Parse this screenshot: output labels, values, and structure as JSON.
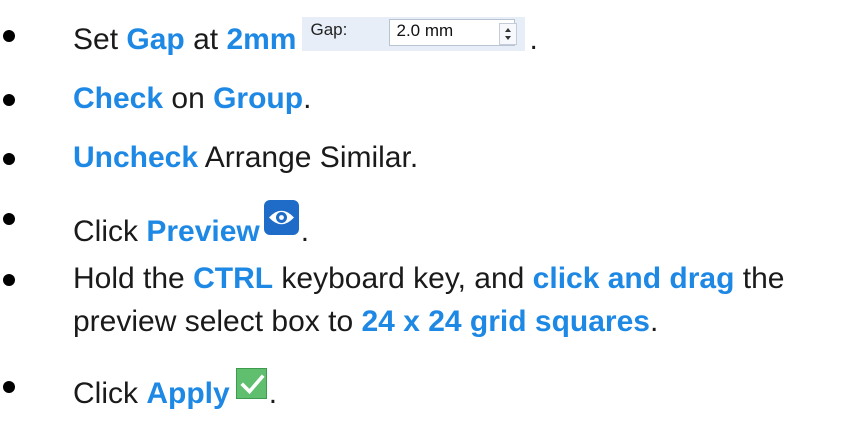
{
  "items": [
    {
      "parts": {
        "p1": "Set ",
        "p2": "Gap",
        "p3": " at ",
        "p4": "2mm",
        "p5": "."
      },
      "widget": {
        "label": "Gap:",
        "value": "2.0 mm"
      }
    },
    {
      "parts": {
        "p1": "Check",
        "p2": " on ",
        "p3": "Group",
        "p4": "."
      }
    },
    {
      "parts": {
        "p1": "Uncheck",
        "p2": " Arrange Similar."
      }
    },
    {
      "parts": {
        "p1": "Click ",
        "p2": "Preview",
        "p3": "."
      },
      "icon": "eye-icon"
    },
    {
      "parts": {
        "p1": "Hold the ",
        "p2": "CTRL",
        "p3": " keyboard key, and ",
        "p4": "click and drag",
        "p5": " the",
        "p6": "preview select box to ",
        "p7": "24 x 24 grid squares",
        "p8": "."
      }
    },
    {
      "parts": {
        "p1": "Click ",
        "p2": "Apply",
        "p3": "."
      },
      "icon": "checkmark-icon"
    }
  ],
  "colors": {
    "highlight": "#1e88e5",
    "text": "#1a1a1a",
    "preview_icon_bg": "#1e6cc8",
    "apply_icon_bg": "#5fbf6e"
  }
}
